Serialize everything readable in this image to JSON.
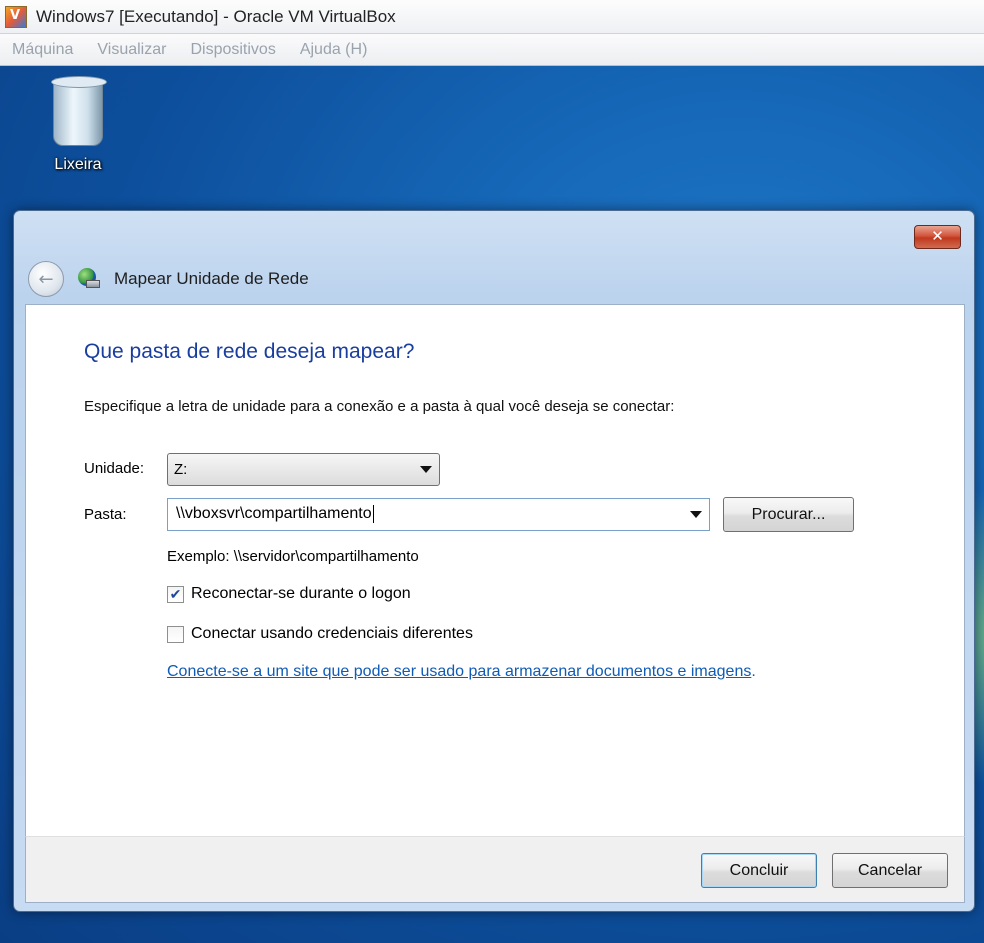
{
  "vbox": {
    "title": "Windows7 [Executando] - Oracle VM VirtualBox",
    "menu": [
      "Máquina",
      "Visualizar",
      "Dispositivos",
      "Ajuda (H)"
    ]
  },
  "desktop": {
    "recycle_bin_label": "Lixeira"
  },
  "dialog": {
    "close_glyph": "✕",
    "title": "Mapear Unidade de Rede",
    "heading": "Que pasta de rede deseja mapear?",
    "instruction": "Especifique a letra de unidade para a conexão e a pasta à qual você deseja se conectar:",
    "drive_label": "Unidade:",
    "drive_value": "Z:",
    "folder_label": "Pasta:",
    "folder_value": "\\\\vboxsvr\\compartilhamento",
    "browse_label": "Procurar...",
    "example": "Exemplo: \\\\servidor\\compartilhamento",
    "reconnect_label": "Reconectar-se durante o logon",
    "reconnect_checked": true,
    "credentials_label": "Conectar usando credenciais diferentes",
    "credentials_checked": false,
    "link_text": "Conecte-se a um site que pode ser usado para armazenar documentos e imagens",
    "link_suffix": ".",
    "finish_label": "Concluir",
    "cancel_label": "Cancelar"
  }
}
